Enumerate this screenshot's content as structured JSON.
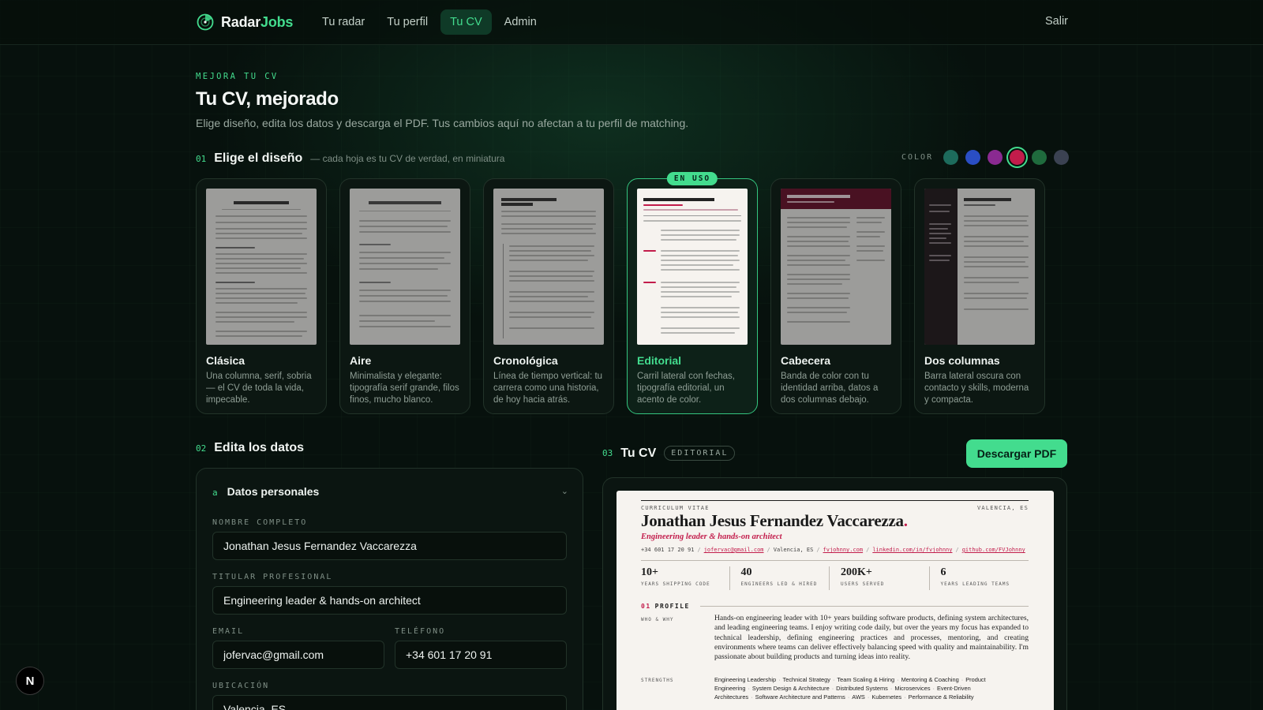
{
  "app": {
    "brand_main": "Radar",
    "brand_accent": "Jobs"
  },
  "nav": {
    "items": [
      "Tu radar",
      "Tu perfil",
      "Tu CV",
      "Admin"
    ],
    "active": "Tu CV",
    "logout": "Salir"
  },
  "header": {
    "eyebrow": "MEJORA TU CV",
    "title": "Tu CV, mejorado",
    "subtitle": "Elige diseño, edita los datos y descarga el PDF. Tus cambios aquí no afectan a tu perfil de matching."
  },
  "design": {
    "num": "01",
    "title": "Elige el diseño",
    "hint": "— cada hoja es tu CV de verdad, en miniatura",
    "color_label": "COLOR",
    "colors": [
      "#1d6b5c",
      "#2a4ec4",
      "#8a2a91",
      "#c21c4b",
      "#1f6b3d",
      "#3b4252"
    ],
    "selected_color": "#c21c4b",
    "active_badge": "EN USO",
    "templates": [
      {
        "name": "Clásica",
        "desc": "Una columna, serif, sobria — el CV de toda la vida, impecable."
      },
      {
        "name": "Aire",
        "desc": "Minimalista y elegante: tipografía serif grande, filos finos, mucho blanco."
      },
      {
        "name": "Cronológica",
        "desc": "Línea de tiempo vertical: tu carrera como una historia, de hoy hacia atrás."
      },
      {
        "name": "Editorial",
        "desc": "Carril lateral con fechas, tipografía editorial, un acento de color."
      },
      {
        "name": "Cabecera",
        "desc": "Banda de color con tu identidad arriba, datos a dos columnas debajo."
      },
      {
        "name": "Dos columnas",
        "desc": "Barra lateral oscura con contacto y skills, moderna y compacta."
      }
    ],
    "active_template": "Editorial"
  },
  "editor": {
    "num": "02",
    "title": "Edita los datos",
    "section_letter": "a",
    "section_title": "Datos personales",
    "fields": {
      "name_label": "NOMBRE COMPLETO",
      "name_value": "Jonathan Jesus Fernandez Vaccarezza",
      "title_label": "TITULAR PROFESIONAL",
      "title_value": "Engineering leader & hands-on architect",
      "email_label": "EMAIL",
      "email_value": "jofervac@gmail.com",
      "phone_label": "TELÉFONO",
      "phone_value": "+34 601 17 20 91",
      "location_label": "UBICACIÓN",
      "location_value": "Valencia, ES"
    }
  },
  "preview": {
    "num": "03",
    "title": "Tu CV",
    "template_pill": "EDITORIAL",
    "download": "Descargar PDF",
    "cv": {
      "kicker": "CURRICULUM VITAE",
      "location_top": "VALENCIA, ES",
      "name": "Jonathan Jesus Fernandez Vaccarezza",
      "name_dot": ".",
      "headline": "Engineering leader & hands-on architect",
      "phone": "+34 601 17 20 91",
      "email": "jofervac@gmail.com",
      "location": "Valencia, ES",
      "site": "fvjohnny.com",
      "linkedin": "linkedin.com/in/fvjohnny",
      "github": "github.com/FVJohnny",
      "stats": [
        {
          "value": "10+",
          "label": "YEARS SHIPPING CODE"
        },
        {
          "value": "40",
          "label": "ENGINEERS LED & HIRED"
        },
        {
          "value": "200K+",
          "label": "USERS SERVED"
        },
        {
          "value": "6",
          "label": "YEARS LEADING TEAMS"
        }
      ],
      "profile_num": "01",
      "profile_title": "PROFILE",
      "profile_side": "WHO & WHY",
      "profile_text": "Hands-on engineering leader with 10+ years building software products, defining system architectures, and leading engineering teams. I enjoy writing code daily, but over the years my focus has expanded to technical leadership, defining engineering practices and processes, mentoring, and creating environments where teams can deliver effectively balancing speed with quality and maintainability. I'm passionate about building products and turning ideas into reality.",
      "strengths_label": "STRENGTHS",
      "strengths": [
        "Engineering Leadership",
        "Technical Strategy",
        "Team Scaling & Hiring",
        "Mentoring & Coaching",
        "Product Engineering",
        "System Design & Architecture",
        "Distributed Systems",
        "Microservices",
        "Event-Driven Architectures",
        "Software Architecture and Patterns",
        "AWS",
        "Kubernetes",
        "Performance & Reliability"
      ]
    }
  },
  "dev_badge": "N"
}
